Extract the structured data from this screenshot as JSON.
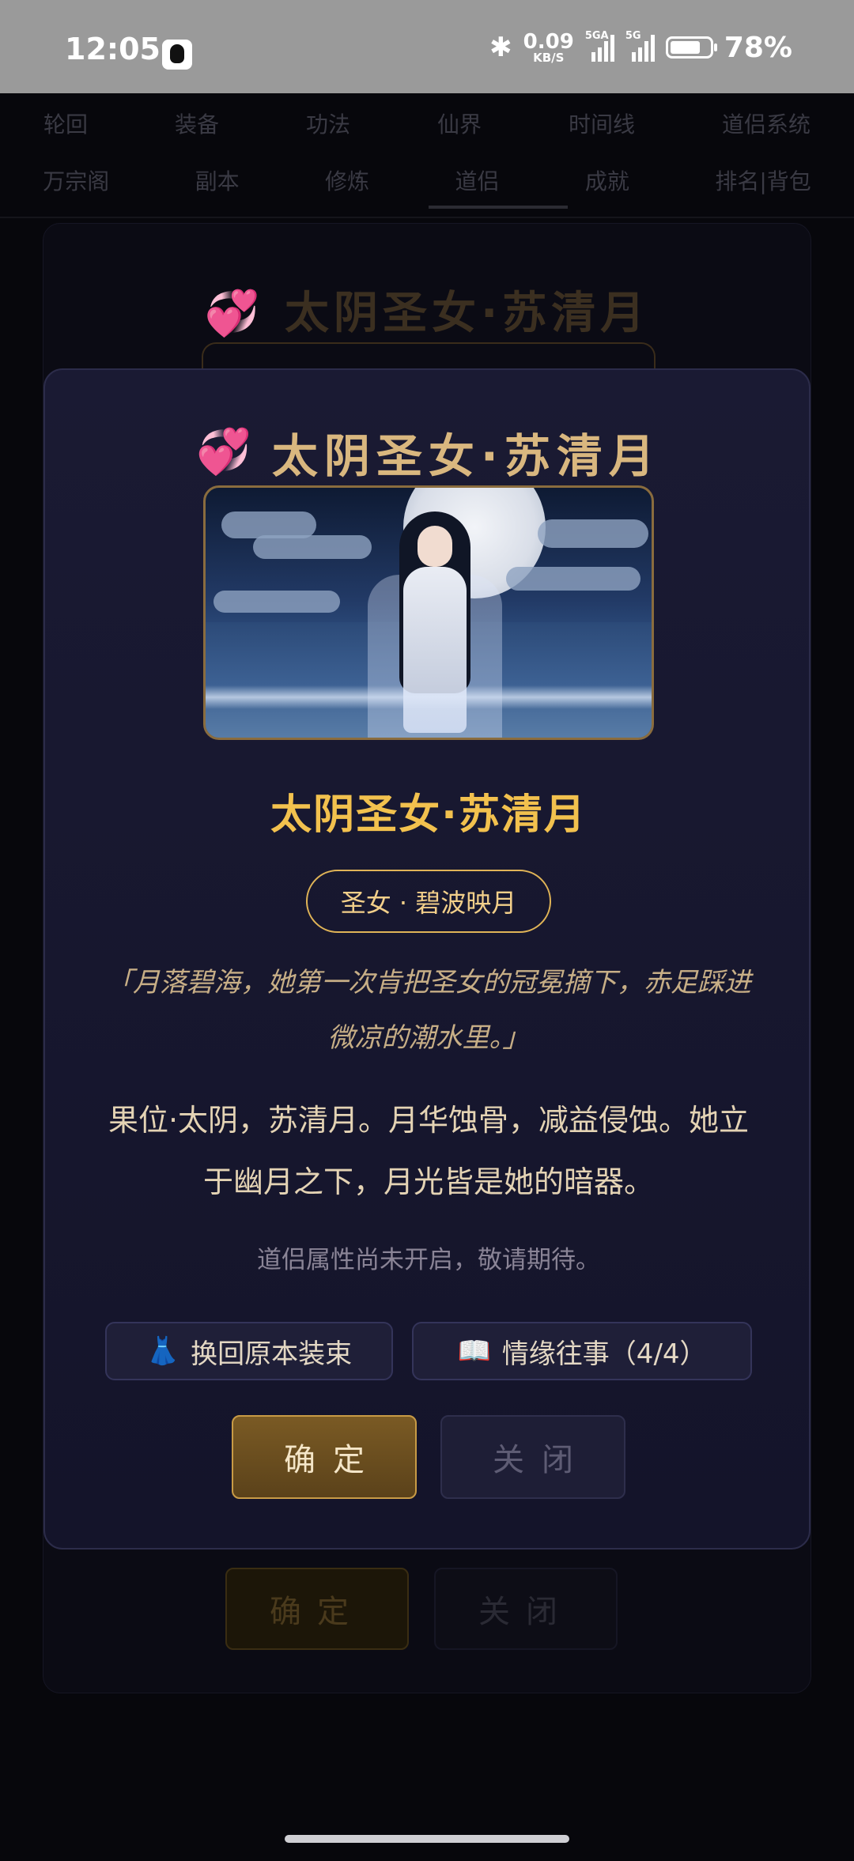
{
  "status_bar": {
    "time": "12:05",
    "net_speed_value": "0.09",
    "net_speed_unit": "KB/S",
    "sim1_tag": "5GA",
    "sim2_tag": "5G",
    "battery_percent": "78%",
    "battery_level": 0.78,
    "icons": [
      "qq-icon",
      "bluetooth-icon",
      "signal-icon",
      "battery-icon"
    ]
  },
  "background": {
    "nav_row1": [
      "轮回",
      "装备",
      "功法",
      "仙界",
      "时间线",
      "道侣系统"
    ],
    "nav_row2": [
      "万宗阁",
      "副本",
      "修炼",
      "道侣",
      "成就",
      "排名|背包"
    ],
    "card_title": "💞 太阴圣女·苏清月",
    "ok_label": "确定",
    "close_label": "关闭"
  },
  "modal": {
    "title_icon": "💞",
    "title": "太阴圣女·苏清月",
    "character_name": "太阴圣女·苏清月",
    "tag": "圣女 · 碧波映月",
    "quote": "「月落碧海，她第一次肯把圣女的冠冕摘下，赤足踩进微凉的潮水里。」",
    "description": "果位·太阴，苏清月。月华蚀骨，减益侵蚀。她立于幽月之下，月光皆是她的暗器。",
    "note": "道侣属性尚未开启，敬请期待。",
    "outfit_button": {
      "icon": "👗",
      "label": "换回原本装束"
    },
    "story_button": {
      "icon": "📖",
      "label": "情缘往事（4/4）"
    },
    "ok_label": "确定",
    "close_label": "关闭",
    "colors": {
      "accent_gold": "#f2c14e",
      "title_gold": "#d9b77f",
      "panel": "#16162e"
    }
  }
}
